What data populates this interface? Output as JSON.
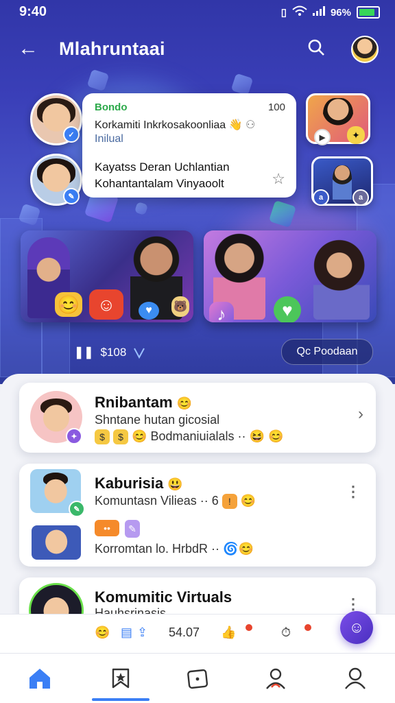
{
  "status_bar": {
    "time": "9:40",
    "battery_text": "96%"
  },
  "app_bar": {
    "title": "Mlahruntaai",
    "back_icon": "arrow-left-icon",
    "search_icon": "search-icon"
  },
  "featured_post": {
    "name": "Bondo",
    "count": "100",
    "line1": "Korkamiti Inkrkosakoonliaa",
    "line2": "Inilual",
    "line3": "Kayatss Deran Uchlantian",
    "line4": "Kohantantalam Vinyaoolt"
  },
  "media_meta": {
    "amount": "$108"
  },
  "podcast_button": {
    "label": "Qc Poodaan"
  },
  "communities": [
    {
      "title": "Rnibantam",
      "subtitle": "Shntane hutan gicosial",
      "meta": "Bodmaniuialals ··"
    },
    {
      "title": "Kaburisia",
      "subtitle": "Komuntasn Vilieas ·· 6",
      "meta2": "Korromtan lo. HrbdR ··"
    },
    {
      "title": "Komumitic Virtuals",
      "subtitle": "Hauhsrinasis"
    }
  ],
  "action_strip": {
    "stat": "54.07"
  },
  "colors": {
    "accent": "#3b7ff5",
    "hero_bg": "#3a3fb8",
    "positive": "#2ca94a",
    "fab": "#6a3fe0"
  },
  "nav": {
    "items": [
      "home-icon",
      "bookmark-star-icon",
      "dice-icon",
      "profile-badge-icon",
      "user-icon"
    ],
    "active": "bookmark-star-icon"
  }
}
